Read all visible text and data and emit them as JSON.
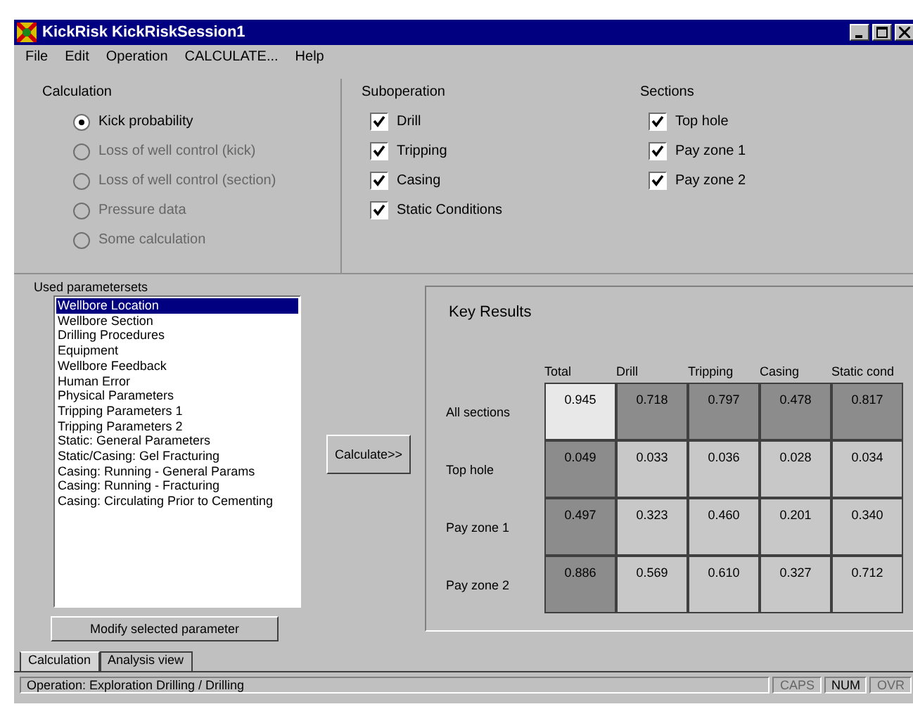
{
  "window": {
    "title": "KickRisk  KickRiskSession1"
  },
  "menu": [
    {
      "label": "File"
    },
    {
      "label": "Edit"
    },
    {
      "label": "Operation"
    },
    {
      "label": "CALCULATE..."
    },
    {
      "label": "Help"
    }
  ],
  "calculation": {
    "title": "Calculation",
    "options": [
      {
        "label": "Kick probability",
        "selected": true,
        "disabled": false
      },
      {
        "label": "Loss of well control (kick)",
        "selected": false,
        "disabled": true
      },
      {
        "label": "Loss of well control (section)",
        "selected": false,
        "disabled": true
      },
      {
        "label": "Pressure data",
        "selected": false,
        "disabled": true
      },
      {
        "label": "Some calculation",
        "selected": false,
        "disabled": true
      }
    ]
  },
  "suboperation": {
    "title": "Suboperation",
    "items": [
      {
        "label": "Drill",
        "checked": true
      },
      {
        "label": "Tripping",
        "checked": true
      },
      {
        "label": "Casing",
        "checked": true
      },
      {
        "label": "Static Conditions",
        "checked": true
      }
    ]
  },
  "sections": {
    "title": "Sections",
    "items": [
      {
        "label": "Top hole",
        "checked": true
      },
      {
        "label": "Pay zone 1",
        "checked": true
      },
      {
        "label": "Pay zone 2",
        "checked": true
      }
    ]
  },
  "parameters": {
    "title": "Used parametersets",
    "items": [
      {
        "label": "Wellbore Location",
        "selected": true
      },
      {
        "label": "Wellbore Section",
        "selected": false
      },
      {
        "label": "Drilling Procedures",
        "selected": false
      },
      {
        "label": "Equipment",
        "selected": false
      },
      {
        "label": "Wellbore Feedback",
        "selected": false
      },
      {
        "label": "Human Error",
        "selected": false
      },
      {
        "label": "Physical Parameters",
        "selected": false
      },
      {
        "label": "Tripping Parameters 1",
        "selected": false
      },
      {
        "label": "Tripping Parameters 2",
        "selected": false
      },
      {
        "label": "Static: General Parameters",
        "selected": false
      },
      {
        "label": "Static/Casing: Gel Fracturing",
        "selected": false
      },
      {
        "label": "Casing: Running - General Params",
        "selected": false
      },
      {
        "label": "Casing: Running - Fracturing",
        "selected": false
      },
      {
        "label": "Casing: Circulating Prior to Cementing",
        "selected": false
      }
    ],
    "modify_button": "Modify selected parameter"
  },
  "calculate_button": "Calculate>>",
  "results": {
    "title": "Key Results",
    "columns": [
      "Total",
      "Drill",
      "Tripping",
      "Casing",
      "Static cond"
    ],
    "rows": [
      {
        "label": "All sections",
        "cells": [
          {
            "value": "0.945",
            "color": "#e8e8e8"
          },
          {
            "value": "0.718",
            "color": "#8c8c8c"
          },
          {
            "value": "0.797",
            "color": "#8c8c8c"
          },
          {
            "value": "0.478",
            "color": "#8c8c8c"
          },
          {
            "value": "0.817",
            "color": "#8c8c8c"
          }
        ]
      },
      {
        "label": "Top hole",
        "cells": [
          {
            "value": "0.049",
            "color": "#8c8c8c"
          },
          {
            "value": "0.033",
            "color": "#c8c8c8"
          },
          {
            "value": "0.036",
            "color": "#c8c8c8"
          },
          {
            "value": "0.028",
            "color": "#c8c8c8"
          },
          {
            "value": "0.034",
            "color": "#c8c8c8"
          }
        ]
      },
      {
        "label": "Pay zone 1",
        "cells": [
          {
            "value": "0.497",
            "color": "#8c8c8c"
          },
          {
            "value": "0.323",
            "color": "#c8c8c8"
          },
          {
            "value": "0.460",
            "color": "#c8c8c8"
          },
          {
            "value": "0.201",
            "color": "#c8c8c8"
          },
          {
            "value": "0.340",
            "color": "#c8c8c8"
          }
        ]
      },
      {
        "label": "Pay zone 2",
        "cells": [
          {
            "value": "0.886",
            "color": "#8c8c8c"
          },
          {
            "value": "0.569",
            "color": "#c8c8c8"
          },
          {
            "value": "0.610",
            "color": "#c8c8c8"
          },
          {
            "value": "0.327",
            "color": "#c8c8c8"
          },
          {
            "value": "0.712",
            "color": "#c8c8c8"
          }
        ]
      }
    ]
  },
  "tabs": [
    {
      "label": "Calculation",
      "selected": true
    },
    {
      "label": "Analysis view",
      "selected": false
    }
  ],
  "status_bar": {
    "text": "Operation:  Exploration Drilling / Drilling",
    "indicators": [
      {
        "label": "CAPS",
        "on": false
      },
      {
        "label": "NUM",
        "on": true
      },
      {
        "label": "OVR",
        "on": false
      }
    ]
  }
}
